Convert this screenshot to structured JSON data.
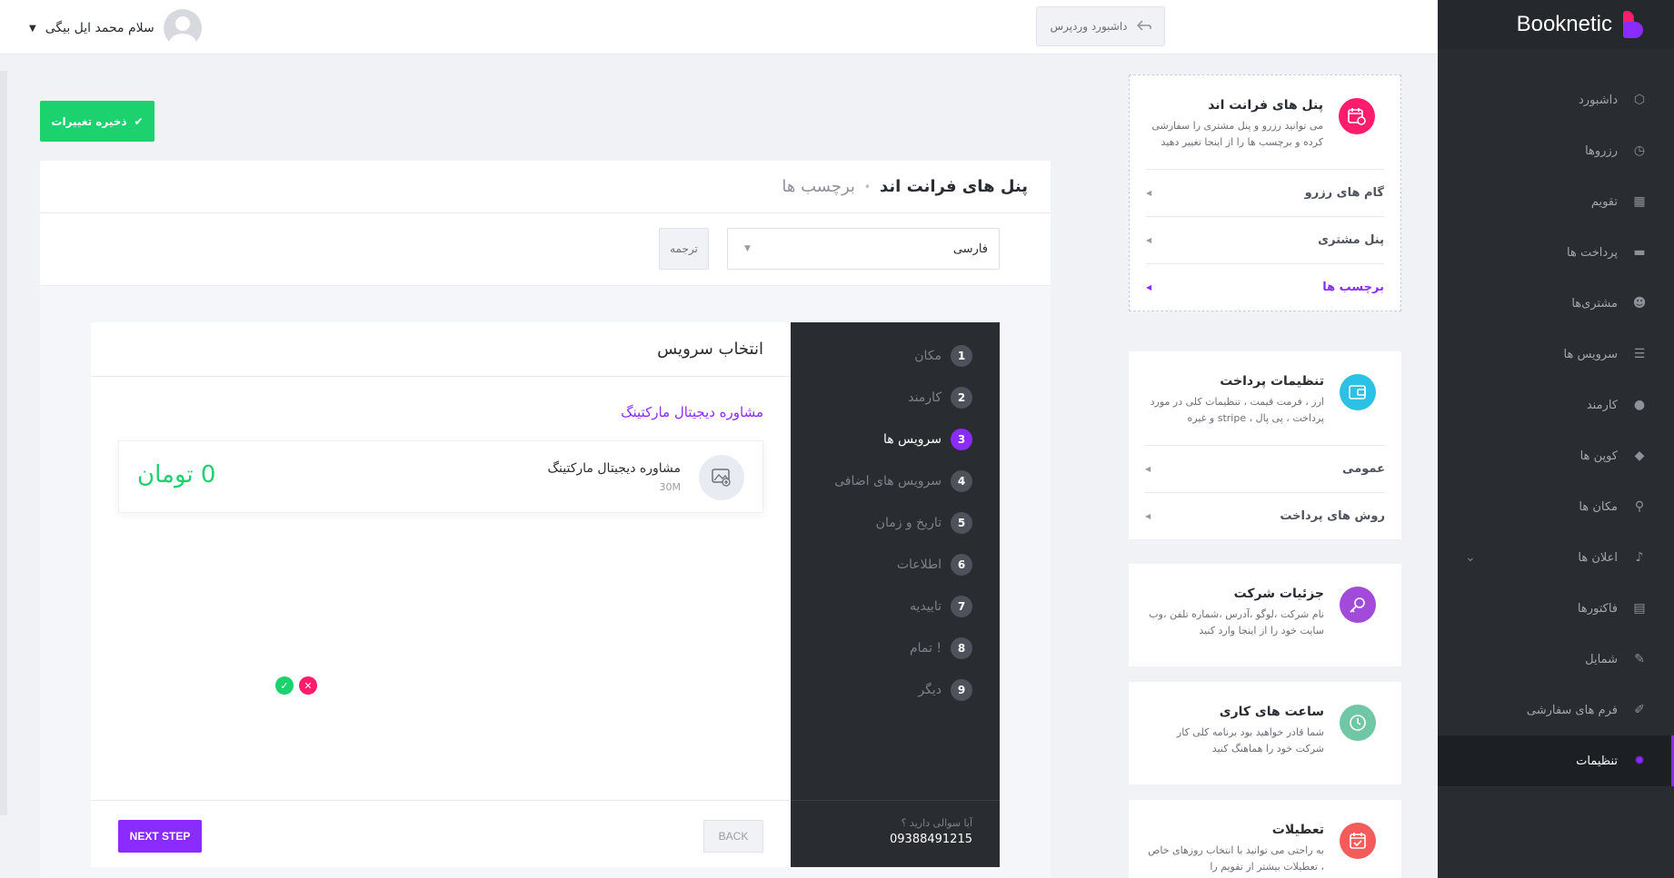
{
  "sidebar": {
    "brand": "Booknetic",
    "items": [
      {
        "label": "داشبورد",
        "icon": "cube-icon",
        "glyph": "⬡"
      },
      {
        "label": "رزروها",
        "icon": "clock-icon",
        "glyph": "◷"
      },
      {
        "label": "تقویم",
        "icon": "calendar-icon",
        "glyph": "▦"
      },
      {
        "label": "پرداخت ها",
        "icon": "credit-card-icon",
        "glyph": "▬"
      },
      {
        "label": "مشتری‌ها",
        "icon": "users-icon",
        "glyph": "☻"
      },
      {
        "label": "سرویس ها",
        "icon": "list-icon",
        "glyph": "☰"
      },
      {
        "label": "کارمند",
        "icon": "user-icon",
        "glyph": "●"
      },
      {
        "label": "کوپن ها",
        "icon": "tag-icon",
        "glyph": "◆"
      },
      {
        "label": "مکان ها",
        "icon": "location-icon",
        "glyph": "⚲"
      },
      {
        "label": "اعلان ها",
        "icon": "bell-icon",
        "glyph": "♪"
      },
      {
        "label": "فاکتورها",
        "icon": "invoice-icon",
        "glyph": "▤"
      },
      {
        "label": "شمایل",
        "icon": "brush-icon",
        "glyph": "✎"
      },
      {
        "label": "فرم های سفارشی",
        "icon": "wand-icon",
        "glyph": "✐"
      },
      {
        "label": "تنظیمات",
        "icon": "gear-icon",
        "glyph": "✹"
      }
    ]
  },
  "topbar": {
    "user_name": "سلام محمد ایل بیگی",
    "wp_dashboard": "داشبورد وردپرس"
  },
  "save_button": "ذخیره تغییرات",
  "main": {
    "title": "پنل های فرانت اند",
    "subtitle": "برچسب ها",
    "language": "فارسی",
    "translate_button": "ترجمه"
  },
  "booking": {
    "steps": [
      {
        "num": "1",
        "label": "مکان"
      },
      {
        "num": "2",
        "label": "کارمند"
      },
      {
        "num": "3",
        "label": "سرویس ها"
      },
      {
        "num": "4",
        "label": "سرویس های اضافی"
      },
      {
        "num": "5",
        "label": "تاریخ و زمان"
      },
      {
        "num": "6",
        "label": "اطلاعات"
      },
      {
        "num": "7",
        "label": "تاییدیه"
      },
      {
        "num": "8",
        "label": "تمام !"
      },
      {
        "num": "9",
        "label": "دیگر"
      }
    ],
    "active_step": 2,
    "question": "آیا سوالی دارید ؟",
    "phone": "09388491215",
    "content_title": "انتخاب سرویس",
    "category": "مشاوره دیجیتال مارکتینگ",
    "service": {
      "name": "مشاوره دیجیتال مارکتینگ",
      "duration": "30M",
      "price": "0 تومان"
    },
    "next_button": "NEXT STEP",
    "back_button": "BACK"
  },
  "settings_cards": [
    {
      "title": "پنل های فرانت اند",
      "desc": "می توانید رزرو و پنل مشتری را سفارشی کرده و برچسب ها را از اینجا تغییر دهید",
      "icon": "calendar-gear-icon",
      "color": "#fd1d6c",
      "subs": [
        "گام های رزرو",
        "پنل مشتری",
        "برچسب ها"
      ]
    },
    {
      "title": "تنظیمات پرداخت",
      "desc": "ارز ، فرمت قیمت ، تنظیمات کلی در مورد پرداخت ، پی پال ، stripe و غیره",
      "icon": "wallet-icon",
      "color": "#2bc1e4",
      "subs": [
        "عمومی",
        "روش های پرداخت"
      ]
    },
    {
      "title": "جزئیات شرکت",
      "desc": "نام شرکت ،لوگو ،آدرس ،شماره تلفن ،وب سایت خود را از اینجا وارد کنید",
      "icon": "key-icon",
      "color": "#a24bdb",
      "subs": []
    },
    {
      "title": "ساعت های کاری",
      "desc": "شما قادر خواهید بود برنامه کلی کار شرکت خود را هماهنگ کنید",
      "icon": "clock-icon",
      "color": "#6fc7a6",
      "subs": []
    },
    {
      "title": "تعطیلات",
      "desc": "به راحتی می توانید با انتخاب روزهای خاص ، تعطیلات بیشتر از تقویم را",
      "icon": "calendar-check-icon",
      "color": "#f45b5b",
      "subs": []
    }
  ]
}
